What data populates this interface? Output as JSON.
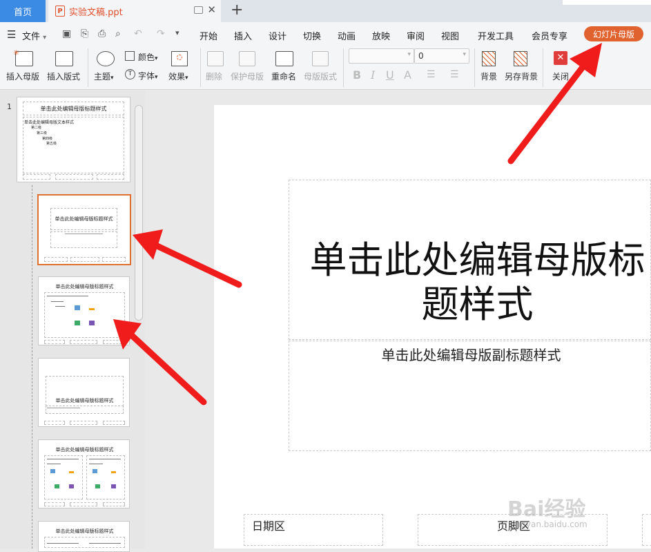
{
  "tabs": {
    "home": "首页",
    "document": "实验文稿.ppt",
    "new_tab": "+"
  },
  "menu": {
    "file": "文件",
    "items": [
      "开始",
      "插入",
      "设计",
      "切换",
      "动画",
      "放映",
      "审阅",
      "视图",
      "开发工具",
      "会员专享"
    ],
    "active": "幻灯片母版"
  },
  "ribbon": {
    "insert_master": "插入母版",
    "insert_layout": "插入版式",
    "theme": "主题",
    "colors": "颜色",
    "fonts": "字体",
    "effects": "效果",
    "delete": "删除",
    "protect_master": "保护母版",
    "rename": "重命名",
    "master_layout": "母版版式",
    "font_size_value": "0",
    "background": "背景",
    "save_background": "另存背景",
    "close": "关闭",
    "format_icons": [
      "B",
      "I",
      "U",
      "A"
    ]
  },
  "slides_panel": {
    "master_number": "1",
    "master_title": "单击此处编辑母版标题样式",
    "master_body": [
      "单击此处编辑母版文本样式",
      "第二级",
      "第三级",
      "第四级",
      "第五级"
    ],
    "thumbs": [
      {
        "title": "单击此处编辑母版标题样式"
      },
      {
        "title": "单击此处编辑母版标题样式"
      },
      {
        "title": "单击此处编辑母版标题样式"
      },
      {
        "title": "单击此处编辑母版标题样式"
      },
      {
        "title": "单击此处编辑母版标题样式"
      }
    ]
  },
  "slide": {
    "title": "单击此处编辑母版标题样式",
    "subtitle": "单击此处编辑母版副标题样式",
    "date": "日期区",
    "footer": "页脚区"
  },
  "watermark": {
    "text": "Bai经验",
    "url": "jingyan.baidu.com"
  },
  "colors": {
    "accent": "#e0622f",
    "home_tab": "#3b8ae4",
    "arrow": "#f01c1c"
  }
}
